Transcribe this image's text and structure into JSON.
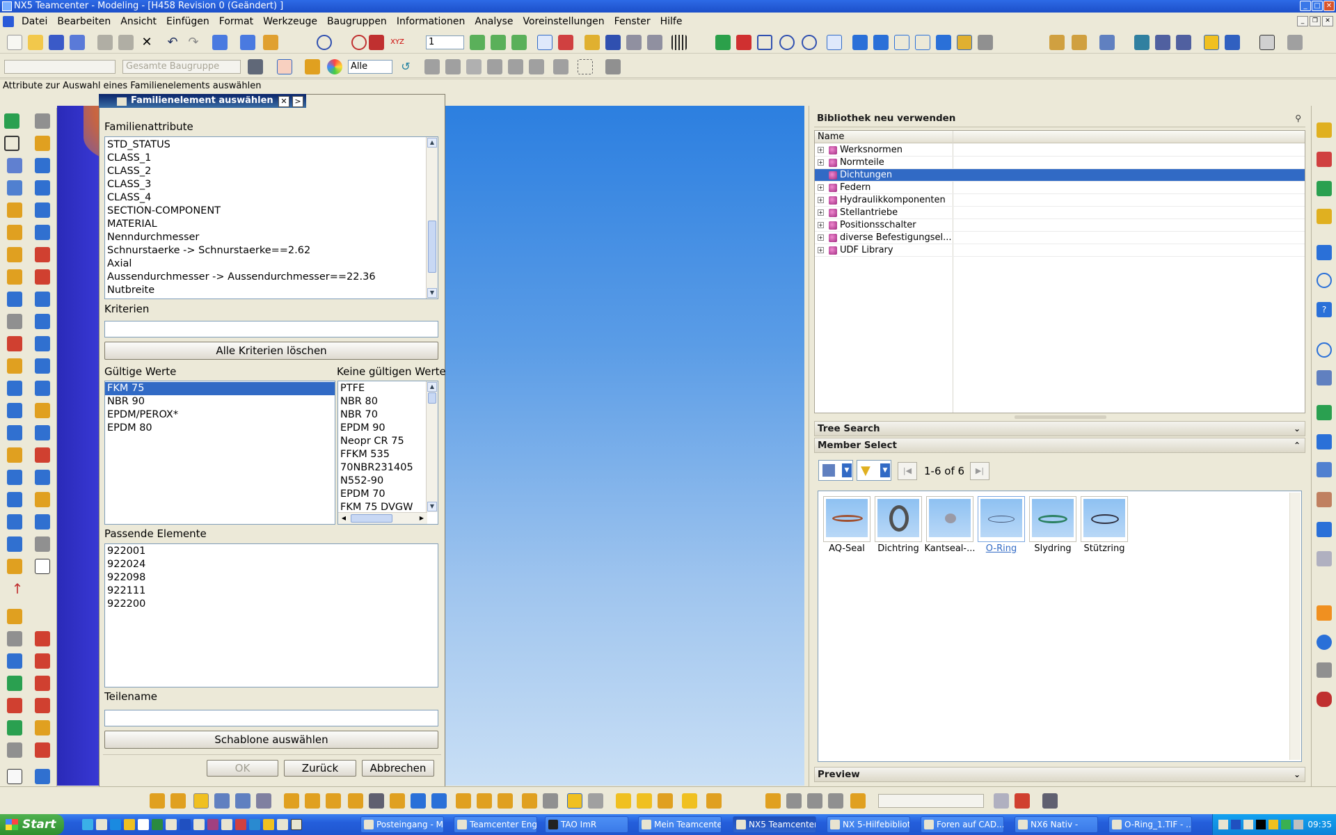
{
  "window": {
    "title": "NX5 Teamcenter - Modeling - [H458 Revision 0 (Geändert) ]"
  },
  "menu": [
    "Datei",
    "Bearbeiten",
    "Ansicht",
    "Einfügen",
    "Format",
    "Werkzeuge",
    "Baugruppen",
    "Informationen",
    "Analyse",
    "Voreinstellungen",
    "Fenster",
    "Hilfe"
  ],
  "toolbar": {
    "layer_value": "1",
    "assembly_filter": "Gesamte Baugruppe",
    "type_filter": "Alle"
  },
  "prompt": "Attribute zur Auswahl eines Familienelements auswählen",
  "dialog": {
    "title": "Familienelement auswählen",
    "family_attributes_label": "Familienattribute",
    "family_attributes": [
      "STD_STATUS",
      "CLASS_1",
      "CLASS_2",
      "CLASS_3",
      "CLASS_4",
      "SECTION-COMPONENT",
      "MATERIAL",
      "Nenndurchmesser",
      "Schnurstaerke -> Schnurstaerke==2.62",
      "Axial",
      "Aussendurchmesser -> Aussendurchmesser==22.36",
      "Nutbreite"
    ],
    "criteria_label": "Kriterien",
    "criteria_value": "",
    "clear_criteria_button": "Alle Kriterien löschen",
    "valid_values_label": "Gültige Werte",
    "valid_values": [
      "FKM 75",
      "NBR 90",
      "EPDM/PEROX*",
      "EPDM 80"
    ],
    "invalid_values_label": "Keine gültigen Werte",
    "invalid_values": [
      "PTFE",
      "NBR 80",
      "NBR 70",
      "EPDM 90",
      "Neopr CR 75",
      "FFKM 535",
      "70NBR231405",
      "N552-90",
      "EPDM 70",
      "FKM 75 DVGW"
    ],
    "matching_label": "Passende Elemente",
    "matching_elements": [
      "922001",
      "922024",
      "922098",
      "922111",
      "922200"
    ],
    "partname_label": "Teilename",
    "partname_value": "",
    "template_button": "Schablone auswählen",
    "ok_button": "OK",
    "back_button": "Zurück",
    "cancel_button": "Abbrechen"
  },
  "library": {
    "title": "Bibliothek neu verwenden",
    "column_name": "Name",
    "items": [
      "Werksnormen",
      "Normteile",
      "Dichtungen",
      "Federn",
      "Hydraulikkomponenten",
      "Stellantriebe",
      "Positionsschalter",
      "diverse Befestigungsel...",
      "UDF Library"
    ],
    "selected_index": 2
  },
  "tree_search": {
    "title": "Tree Search"
  },
  "member_select": {
    "title": "Member Select",
    "page_info": "1-6 of 6",
    "members": [
      "AQ-Seal",
      "Dichtring",
      "Kantseal-...",
      "O-Ring",
      "Slydring",
      "Stützring"
    ],
    "selected": "O-Ring"
  },
  "preview": {
    "title": "Preview"
  },
  "taskbar": {
    "start": "Start",
    "tasks": [
      "Posteingang - M...",
      "Teamcenter Eng...",
      "TAO ImR",
      "Mein Teamcente...",
      "NX5 Teamcenter...",
      "NX 5-Hilfebibliot...",
      "Foren auf CAD....",
      "NX6 Nativ -",
      "O-Ring_1.TIF - ..."
    ],
    "active_task": 4,
    "clock": "09:35"
  },
  "colors": {
    "selection": "#316ac5",
    "titlebar": "#1c4fc9",
    "viewport_top": "#2c7fe0"
  }
}
